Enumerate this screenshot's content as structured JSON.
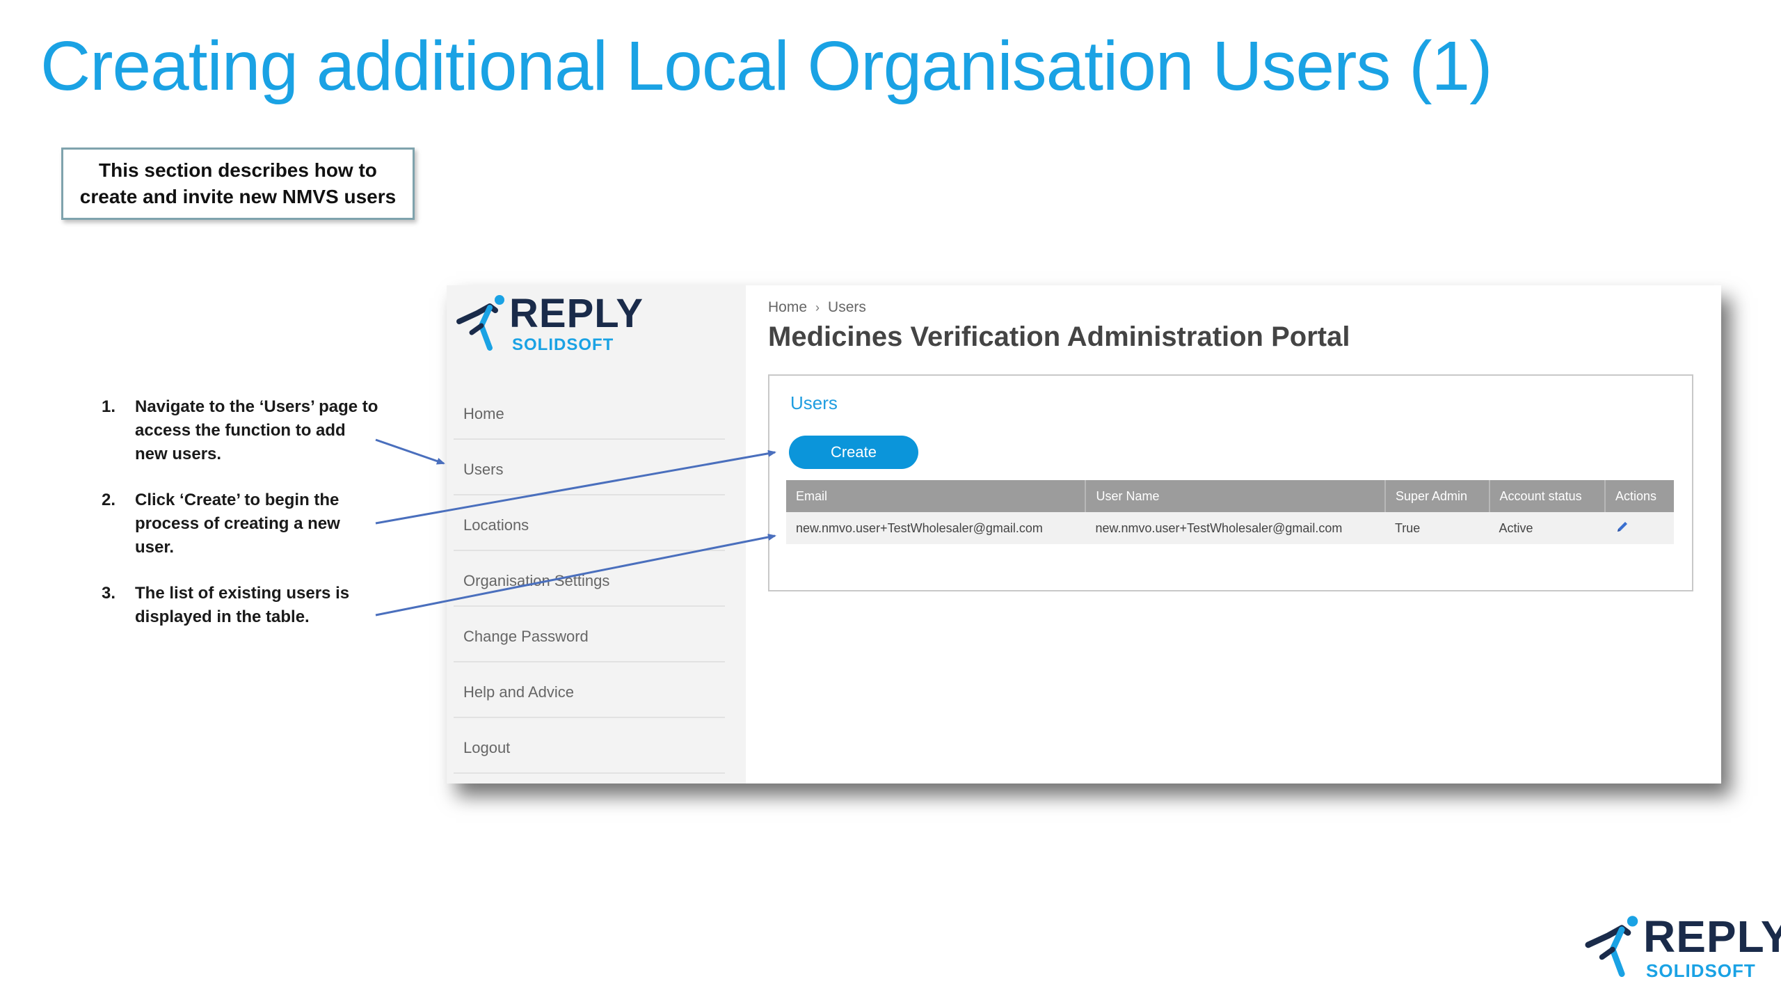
{
  "slide": {
    "title": "Creating additional Local Organisation Users (1)",
    "intro_line1": "This section describes how to",
    "intro_line2": "create and invite new NMVS users"
  },
  "steps": [
    {
      "num": "1.",
      "text": "Navigate to the ‘Users’ page to access the function to add new users."
    },
    {
      "num": "2.",
      "text": "Click ‘Create’ to begin the process of creating a new user."
    },
    {
      "num": "3.",
      "text": "The list of existing users is displayed in the table."
    }
  ],
  "logo": {
    "word1": "REPLY",
    "word2": "SOLIDSOFT"
  },
  "colors": {
    "accent": "#1aa2e4",
    "button": "#0b95da",
    "navy": "#1a2b4a",
    "table_header": "#9c9c9c",
    "arrow": "#4a6fbd"
  },
  "portal": {
    "breadcrumb": {
      "home": "Home",
      "separator": "›",
      "current": "Users"
    },
    "title": "Medicines Verification Administration Portal",
    "nav": [
      "Home",
      "Users",
      "Locations",
      "Organisation Settings",
      "Change Password",
      "Help and Advice",
      "Logout"
    ],
    "panel": {
      "heading": "Users",
      "create_label": "Create",
      "columns": [
        "Email",
        "User Name",
        "Super Admin",
        "Account status",
        "Actions"
      ],
      "rows": [
        {
          "email": "new.nmvo.user+TestWholesaler@gmail.com",
          "user_name": "new.nmvo.user+TestWholesaler@gmail.com",
          "super_admin": "True",
          "status": "Active",
          "action_icon": "pencil-edit-icon"
        }
      ]
    }
  }
}
